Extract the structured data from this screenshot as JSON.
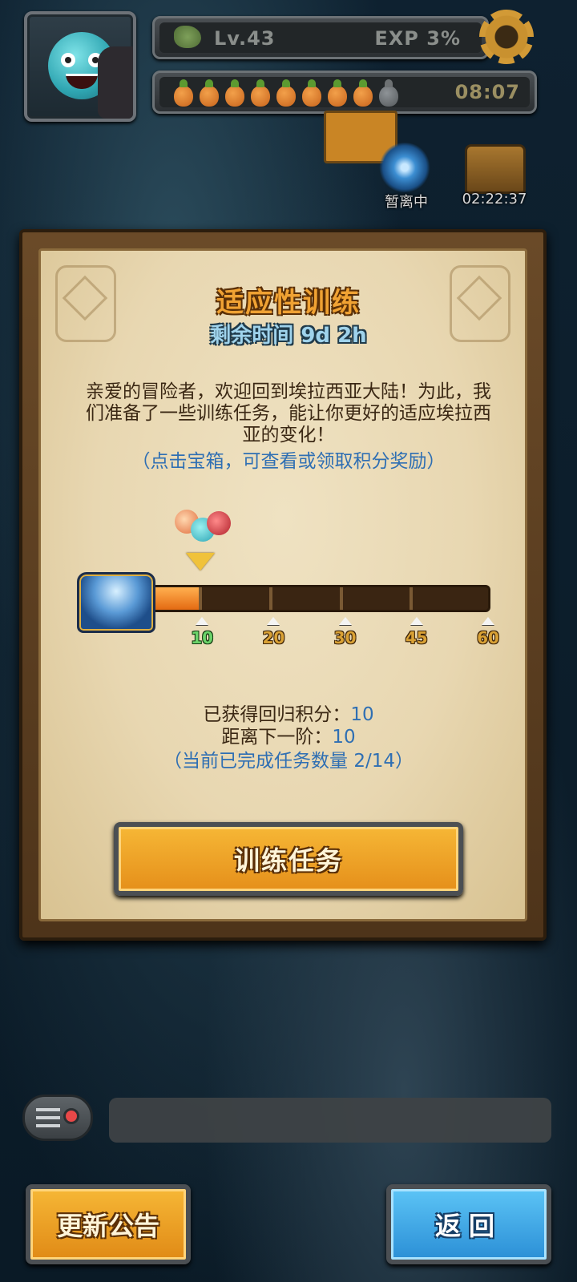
{
  "hud": {
    "level": "Lv.43",
    "exp": "EXP  3%",
    "energy_timer": "08:07",
    "energy": {
      "filled": 8,
      "total": 9
    }
  },
  "map": {
    "portal_label": "暂离中",
    "chest_timer": "02:22:37"
  },
  "panel": {
    "title": "适应性训练",
    "subtitle": "剩余时间 9d 2h",
    "description": "亲爱的冒险者，欢迎回到埃拉西亚大陆！为此，我们准备了一些训练任务，能让你更好的适应埃拉西亚的变化！",
    "hint": "（点击宝箱，可查看或领取积分奖励）",
    "progress": {
      "current": 10,
      "max": 60,
      "milestones": [
        "10",
        "20",
        "30",
        "45",
        "60"
      ]
    },
    "earned_label": "已获得回归积分：",
    "earned_value": "10",
    "next_label": "距离下一阶：",
    "next_value": "10",
    "completed_text": "（当前已完成任务数量 2/14）",
    "train_button": "训练任务"
  },
  "bottom": {
    "notice_button": "更新公告",
    "back_button": "返回"
  },
  "colors": {
    "accent_orange": "#f0a233",
    "hint_blue": "#2f6fb3",
    "back_blue": "#2b8fd6"
  }
}
